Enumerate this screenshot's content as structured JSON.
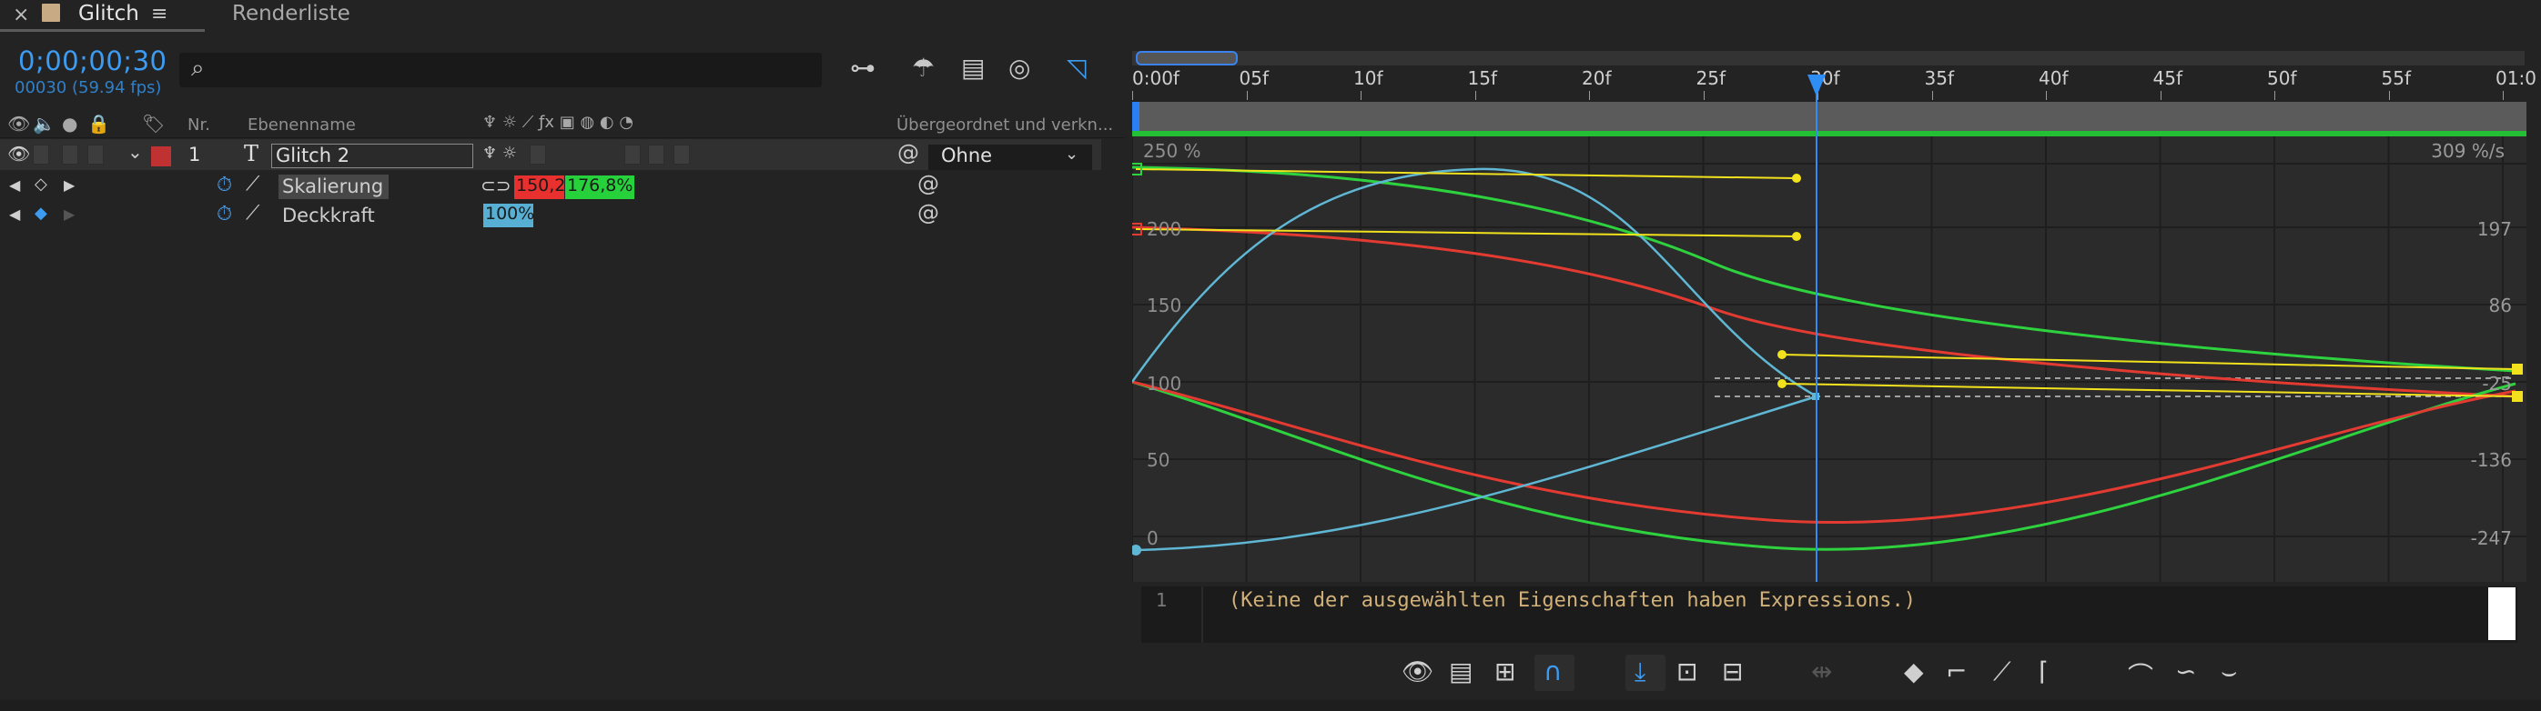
{
  "tab": {
    "close": "×",
    "title": "Glitch",
    "menu": "≡",
    "render_queue": "Renderliste"
  },
  "time": {
    "timecode": "0;00;00;30",
    "frames": "00030 (59.94 fps)"
  },
  "columns": {
    "nr": "Nr.",
    "name": "Ebenenname",
    "parent": "Übergeordnet und verkn..."
  },
  "layer": {
    "number": "1",
    "type_icon": "T",
    "name": "Glitch 2",
    "parent": "Ohne",
    "label_color": "#c03232"
  },
  "properties": [
    {
      "name": "Skalierung",
      "value_x": "150,2,",
      "value_y": "176,8%",
      "link": "⊂⊃"
    },
    {
      "name": "Deckkraft",
      "value": "100%"
    }
  ],
  "ruler": {
    "labels": [
      "0:00f",
      "05f",
      "10f",
      "15f",
      "20f",
      "25f",
      "30f",
      "35f",
      "40f",
      "45f",
      "50f",
      "55f",
      "01:0"
    ]
  },
  "graph": {
    "left_top": "250 %",
    "right_top": "309 %/s",
    "left_labels": [
      "200",
      "150",
      "100",
      "50",
      "0"
    ],
    "right_labels": [
      "197",
      "86",
      "-25",
      "-136",
      "-247"
    ],
    "colors": {
      "red": "#e33b32",
      "green": "#2ed23e",
      "cyan": "#5fb7d4",
      "yellow": "#f1e21d",
      "playhead": "#2f8ef5"
    }
  },
  "expression": {
    "line": "1",
    "text": "(Keine der ausgewählten Eigenschaften haben Expressions.)"
  },
  "icons": {
    "search": "search-icon",
    "eye": "eye-icon",
    "audio": "audio-icon",
    "solo": "solo-icon",
    "lock": "lock-icon"
  }
}
